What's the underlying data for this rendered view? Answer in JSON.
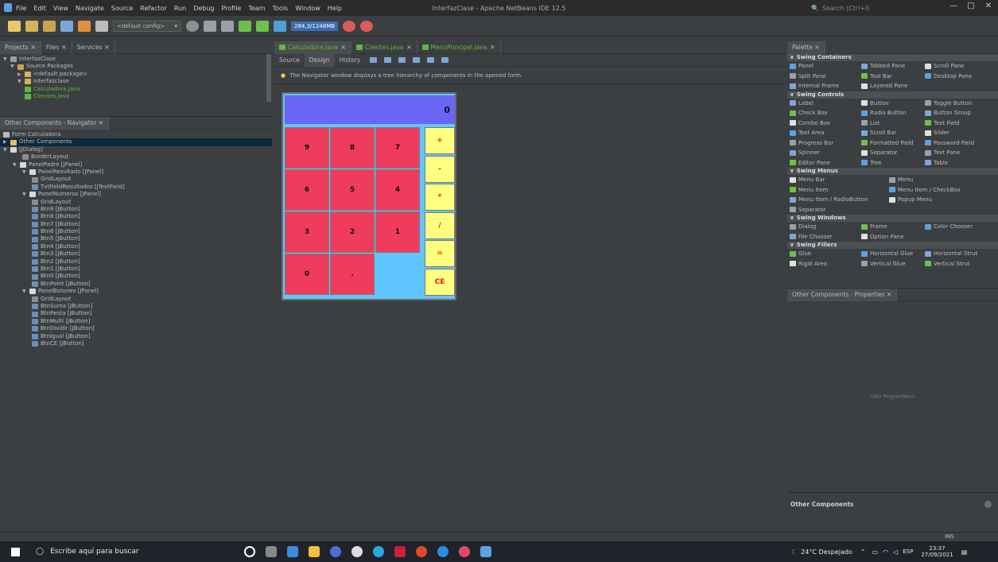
{
  "window": {
    "title": "InterfazClase - Apache NetBeans IDE 12.5",
    "search_placeholder": "Search (Ctrl+I)",
    "menu": [
      "File",
      "Edit",
      "View",
      "Navigate",
      "Source",
      "Refactor",
      "Run",
      "Debug",
      "Profile",
      "Team",
      "Tools",
      "Window",
      "Help"
    ]
  },
  "toolbar": {
    "config": "<default config>",
    "memory": "284,3/1248MB"
  },
  "projects": {
    "tabs": [
      "Projects",
      "Files",
      "Services"
    ],
    "tree": [
      {
        "label": "InterfazClase",
        "indent": 0
      },
      {
        "label": "Source Packages",
        "indent": 1
      },
      {
        "label": "<default package>",
        "indent": 2
      },
      {
        "label": "interfazclase",
        "indent": 2
      },
      {
        "label": "Calculadora.java",
        "indent": 3
      },
      {
        "label": "Clientes.java",
        "indent": 3
      }
    ]
  },
  "navigator": {
    "title": "Other Components - Navigator",
    "rows": [
      {
        "label": "Form Calculadora",
        "indent": 0
      },
      {
        "label": "Other Components",
        "indent": 0
      },
      {
        "label": "[JDialog]",
        "indent": 0
      },
      {
        "label": "BorderLayout",
        "indent": 2
      },
      {
        "label": "PanelPadre [JPanel]",
        "indent": 1
      },
      {
        "label": "PanelResultado [JPanel]",
        "indent": 2
      },
      {
        "label": "GridLayout",
        "indent": 3
      },
      {
        "label": "TxtFieldResultados [JTextField]",
        "indent": 3
      },
      {
        "label": "PanelNumeros [JPanel]",
        "indent": 2
      },
      {
        "label": "GridLayout",
        "indent": 3
      },
      {
        "label": "Btn9 [JButton]",
        "indent": 3
      },
      {
        "label": "Btn8 [JButton]",
        "indent": 3
      },
      {
        "label": "Btn7 [JButton]",
        "indent": 3
      },
      {
        "label": "Btn6 [JButton]",
        "indent": 3
      },
      {
        "label": "Btn5 [JButton]",
        "indent": 3
      },
      {
        "label": "Btn4 [JButton]",
        "indent": 3
      },
      {
        "label": "Btn3 [JButton]",
        "indent": 3
      },
      {
        "label": "Btn2 [JButton]",
        "indent": 3
      },
      {
        "label": "Btn1 [JButton]",
        "indent": 3
      },
      {
        "label": "Btn0 [JButton]",
        "indent": 3
      },
      {
        "label": "BtnPoint [JButton]",
        "indent": 3
      },
      {
        "label": "PanelBotones [JPanel]",
        "indent": 2
      },
      {
        "label": "GridLayout",
        "indent": 3
      },
      {
        "label": "BtnSuma [JButton]",
        "indent": 3
      },
      {
        "label": "BtnResta [JButton]",
        "indent": 3
      },
      {
        "label": "BtnMulti [JButton]",
        "indent": 3
      },
      {
        "label": "BtnDividir [JButton]",
        "indent": 3
      },
      {
        "label": "BtnIgual [JButton]",
        "indent": 3
      },
      {
        "label": "BtnCE [JButton]",
        "indent": 3
      }
    ]
  },
  "editor": {
    "tabs": [
      "Calculadora.java",
      "Clientes.java",
      "MenuPrincipal.java"
    ],
    "subtabs": [
      "Source",
      "Design",
      "History"
    ],
    "info": "The Navigator window displays a tree hierarchy of components in the opened form."
  },
  "calculator": {
    "display": "0",
    "numbers": [
      "9",
      "8",
      "7",
      "6",
      "5",
      "4",
      "3",
      "2",
      "1",
      "0",
      "."
    ],
    "ops": [
      "+",
      "-",
      "*",
      "/",
      "=",
      "CE"
    ]
  },
  "palette": {
    "title": "Palette",
    "sections": [
      {
        "name": "Swing Containers",
        "items": [
          "Panel",
          "Tabbed Pane",
          "Scroll Pane",
          "Split Pane",
          "Tool Bar",
          "Desktop Pane",
          "Internal Frame",
          "Layered Pane"
        ]
      },
      {
        "name": "Swing Controls",
        "items": [
          "Label",
          "Button",
          "Toggle Button",
          "Check Box",
          "Radio Button",
          "Button Group",
          "Combo Box",
          "List",
          "Text Field",
          "Text Area",
          "Scroll Bar",
          "Slider",
          "Progress Bar",
          "Formatted Field",
          "Password Field",
          "Spinner",
          "Separator",
          "Text Pane",
          "Editor Pane",
          "Tree",
          "Table"
        ]
      },
      {
        "name": "Swing Menus",
        "items": [
          "Menu Bar",
          "Menu",
          "Menu Item",
          "Menu Item / CheckBox",
          "Menu Item / RadioButton",
          "Popup Menu",
          "Separator"
        ]
      },
      {
        "name": "Swing Windows",
        "items": [
          "Dialog",
          "Frame",
          "Color Chooser",
          "File Chooser",
          "Option Pane"
        ]
      },
      {
        "name": "Swing Fillers",
        "items": [
          "Glue",
          "Horizontal Glue",
          "Horizontal Strut",
          "Rigid Area",
          "Vertical Glue",
          "Vertical Strut"
        ]
      }
    ]
  },
  "properties": {
    "title": "Other Components - Properties",
    "empty": "<No Properties>",
    "footer": "Other Components"
  },
  "status": {
    "mode": "INS"
  },
  "taskbar": {
    "search": "Escribe aquí para buscar",
    "weather": "24°C Despejado",
    "lang": "ESP",
    "time": "23:37",
    "date": "27/09/2021"
  }
}
